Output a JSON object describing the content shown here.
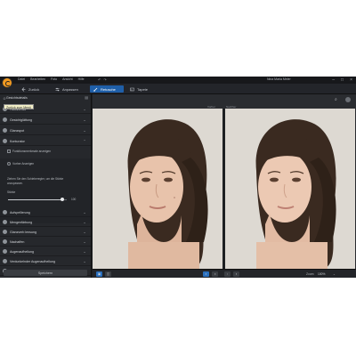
{
  "menu": [
    "Datei",
    "Bearbeiten",
    "Foto",
    "Ansicht",
    "Hilfe"
  ],
  "user": "Nina Maria Meier",
  "toolbar": {
    "back": "Zurück",
    "adjust": "Anpassen",
    "retouch": "Retusche",
    "wallpaper": "Tapete"
  },
  "sidebar": {
    "header_label": "Gesichtsdetails",
    "tooltip": "Zurück zum Menü",
    "accordion": [
      {
        "label": "Hautvorbild"
      },
      {
        "label": "Gesichtglättung"
      },
      {
        "label": "Glanzspot"
      },
      {
        "label": "Konturator"
      }
    ],
    "checkbox_label": "Funktionsmerkmale anzeigen",
    "show_before_label": "Vorher Anzeigen",
    "faint_note": "",
    "description": "Ziehen Sie den Schieberegler, um die Stärke anzupassen.",
    "strength_label": "Stärke",
    "slider_value": "100",
    "slider_fraction": 0.92,
    "lower_accordion": [
      {
        "label": "Aufspellierung"
      },
      {
        "label": "Mengenfärbung"
      },
      {
        "label": "Glanzverb lensung"
      },
      {
        "label": "Nachaffen"
      },
      {
        "label": "Augenaufhellung"
      },
      {
        "label": "Verdunkelnder Augenaufhellung"
      },
      {
        "label": "Zahnaufheller"
      }
    ],
    "save": "Speichern"
  },
  "main": {
    "before_label": "Vorher",
    "after_label": "Nachher",
    "zoom_label": "Zoom:",
    "zoom_value": "100%"
  },
  "colors": {
    "accent": "#1f5fa8",
    "bg": "#1d1f22",
    "panel": "#26282c"
  }
}
